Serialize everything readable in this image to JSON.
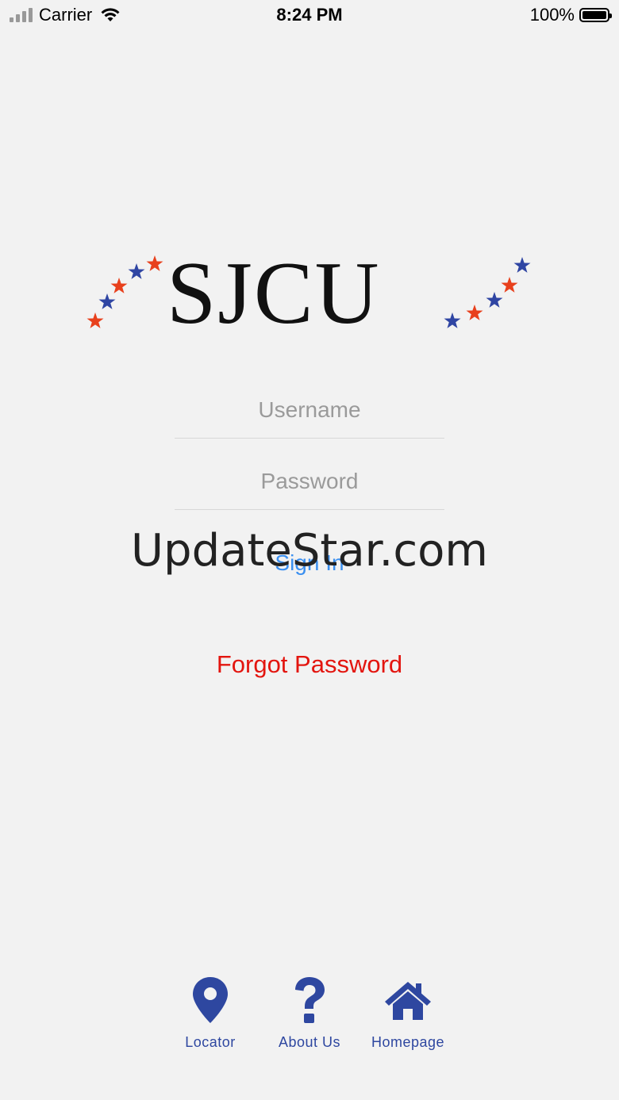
{
  "status_bar": {
    "carrier": "Carrier",
    "time": "8:24 PM",
    "battery": "100%"
  },
  "logo": {
    "text": "SJCU",
    "star_colors": [
      "#e8401c",
      "#2f45a3"
    ]
  },
  "form": {
    "username_placeholder": "Username",
    "password_placeholder": "Password",
    "signin_label": "Sign In",
    "forgot_label": "Forgot Password"
  },
  "watermark": "UpdateStar.com",
  "bottom_nav": {
    "locator": {
      "label": "Locator",
      "icon": "map-pin-icon"
    },
    "about": {
      "label": "About Us",
      "icon": "question-mark-icon"
    },
    "home": {
      "label": "Homepage",
      "icon": "home-icon"
    }
  },
  "colors": {
    "accent_blue": "#2e47a0",
    "link_blue": "#3a8ff0",
    "alert_red": "#e3150f",
    "background": "#f2f2f2"
  }
}
